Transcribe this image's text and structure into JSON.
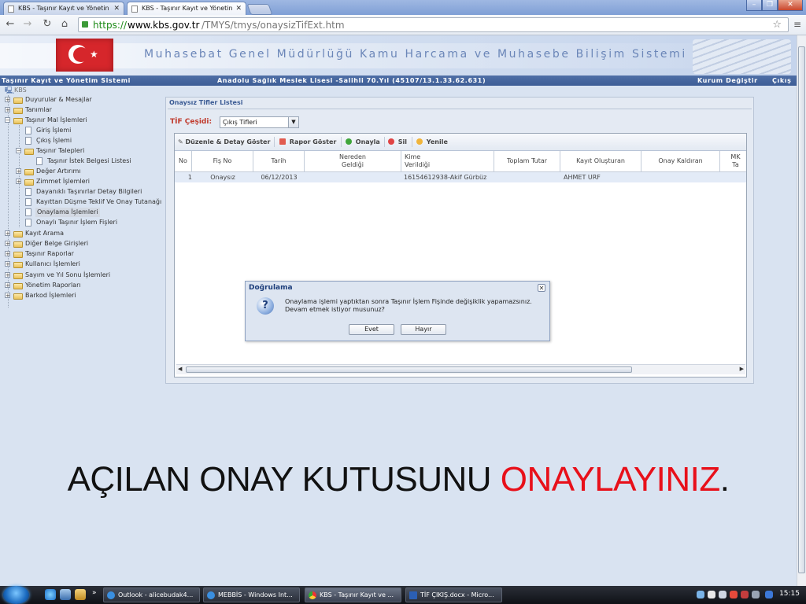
{
  "browser": {
    "tabs": [
      {
        "title": "KBS - Taşınır Kayıt ve Yönetin",
        "active": false
      },
      {
        "title": "KBS - Taşınır Kayıt ve Yönetin",
        "active": true
      }
    ],
    "url": {
      "scheme": "https://",
      "host": "www.kbs.gov.tr",
      "path": "/TMYS/tmys/onaysizTifExt.htm"
    }
  },
  "banner": {
    "title": "Muhasebat Genel Müdürlüğü Kamu Harcama ve Muhasebe Bilişim Sistemi"
  },
  "menubar": {
    "system_name": "Taşınır Kayıt ve Yönetim Sistemi",
    "institution": "Anadolu Sağlık Meslek Lisesi -Salihli 70.Yıl (45107/13.1.33.62.631)",
    "change_institution": "Kurum Değiştir",
    "logout": "Çıkış"
  },
  "tree": {
    "root": "KBS",
    "items": [
      {
        "label": "Duyurular & Mesajlar"
      },
      {
        "label": "Tanımlar"
      },
      {
        "label": "Taşınır Mal İşlemleri"
      },
      {
        "label": "Giriş İşlemi"
      },
      {
        "label": "Çıkış İşlemi"
      },
      {
        "label": "Taşınır Talepleri"
      },
      {
        "label": "Taşınır İstek Belgesi Listesi"
      },
      {
        "label": "Değer Artırımı"
      },
      {
        "label": "Zimmet İşlemleri"
      },
      {
        "label": "Dayanıklı Taşınırlar Detay Bilgileri"
      },
      {
        "label": "Kayıttan Düşme Teklif Ve Onay Tutanağı"
      },
      {
        "label": "Onaylama İşlemleri"
      },
      {
        "label": "Onaylı Taşınır İşlem Fişleri"
      },
      {
        "label": "Kayıt Arama"
      },
      {
        "label": "Diğer Belge Girişleri"
      },
      {
        "label": "Taşınır Raporlar"
      },
      {
        "label": "Kullanıcı İşlemleri"
      },
      {
        "label": "Sayım ve Yıl Sonu İşlemleri"
      },
      {
        "label": "Yönetim Raporları"
      },
      {
        "label": "Barkod İşlemleri"
      }
    ]
  },
  "panel": {
    "title": "Onaysız Tifler Listesi",
    "tif_label": "TİF Çeşidi:",
    "tif_select_value": "Çıkış Tifleri",
    "toolbar": {
      "edit": "Düzenle & Detay Göster",
      "report": "Rapor Göster",
      "approve": "Onayla",
      "delete": "Sil",
      "refresh": "Yenile"
    },
    "columns": [
      "No",
      "Fiş No",
      "Tarih",
      "Nereden\nGeldiği",
      "Kime\nVerildiği",
      "Toplam Tutar",
      "Kayıt Oluşturan",
      "Onay Kaldıran",
      "MK\nTa"
    ],
    "rows": [
      {
        "no": "1",
        "fis_no": "Onaysız",
        "tarih": "06/12/2013",
        "nereden": "",
        "kime": "16154612938-Akif Gürbüz",
        "toplam": "",
        "olusturan": "AHMET URF",
        "kaldiran": "",
        "mk": ""
      }
    ]
  },
  "dialog": {
    "title": "Doğrulama",
    "message_line1": "Onaylama işlemi yaptıktan sonra Taşınır İşlem Fişinde değişiklik yapamazsınız.",
    "message_line2": "Devam etmek istiyor musunuz?",
    "yes": "Evet",
    "no": "Hayır"
  },
  "caption": {
    "part1": "AÇILAN ONAY KUTUSUNU ",
    "part2": "ONAYLAYINIZ",
    "part3": ".",
    "accent_color": "#e8101a"
  },
  "taskbar": {
    "buttons": [
      {
        "label": "Outlook - alicebudak4..."
      },
      {
        "label": "MEBBİS - Windows Int..."
      },
      {
        "label": "KBS - Taşınır Kayıt ve ..."
      },
      {
        "label": "TİF ÇIKIŞ.docx - Micro..."
      }
    ],
    "clock": "15:15"
  }
}
